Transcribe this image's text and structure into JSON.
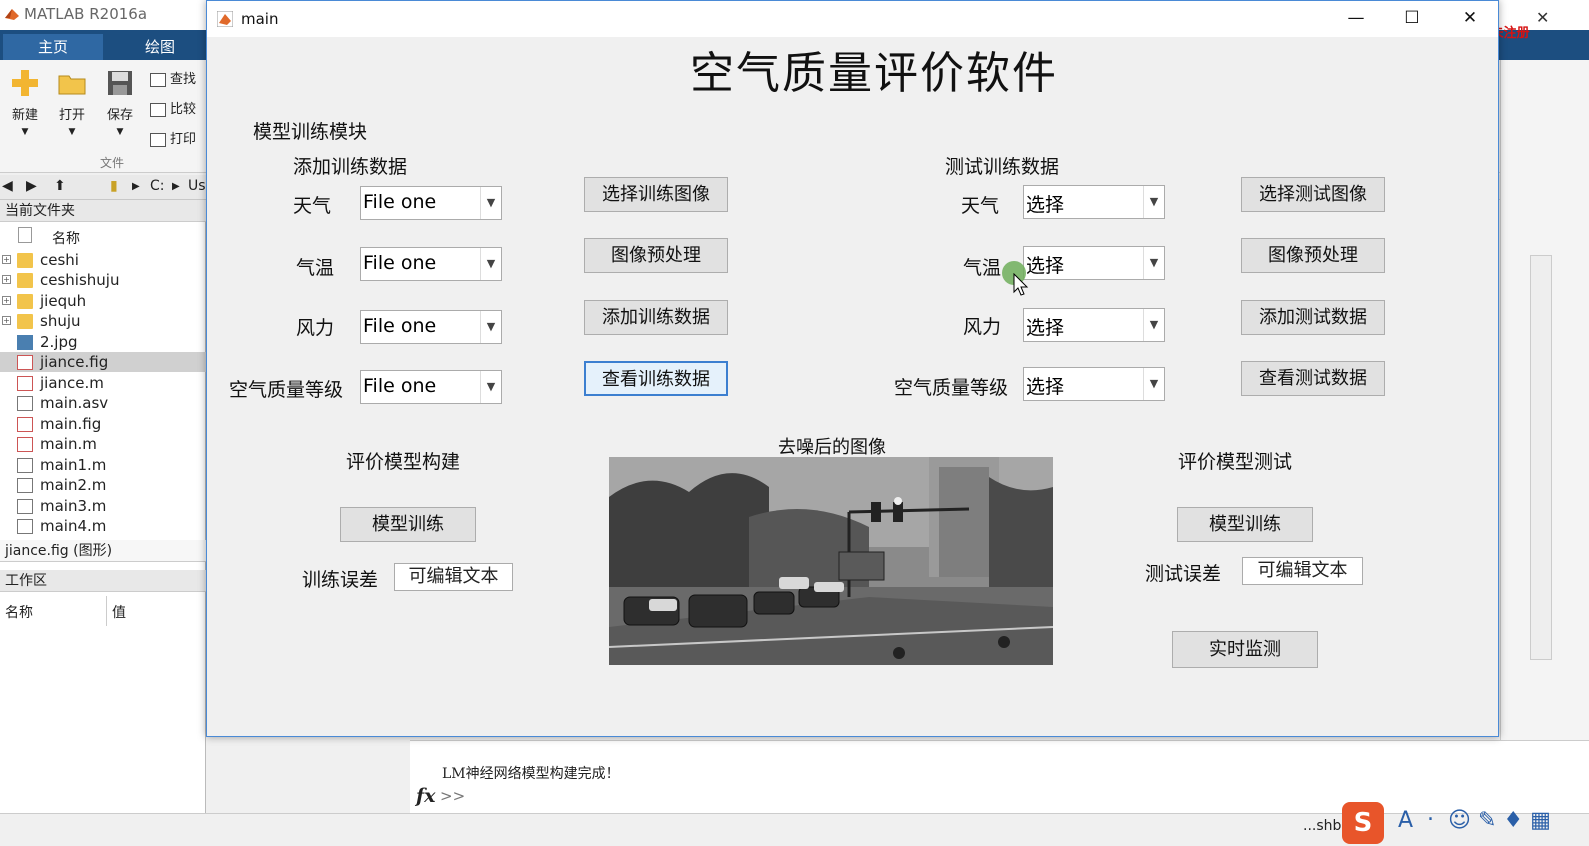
{
  "matlab": {
    "app_title": "MATLAB R2016a",
    "tabs": [
      "主页",
      "绘图"
    ],
    "ribbon": {
      "new": "新建",
      "open": "打开",
      "save": "保存",
      "find": "查找",
      "compare": "比较",
      "print": "打印",
      "group": "文件"
    },
    "address": {
      "drive": "C:",
      "user": "Us"
    },
    "current_folder": {
      "header": "当前文件夹",
      "column": "名称",
      "items": [
        {
          "name": "ceshi",
          "type": "folder"
        },
        {
          "name": "ceshishuju",
          "type": "folder"
        },
        {
          "name": "jiequh",
          "type": "folder"
        },
        {
          "name": "shuju",
          "type": "folder"
        },
        {
          "name": "2.jpg",
          "type": "image"
        },
        {
          "name": "jiance.fig",
          "type": "fig"
        },
        {
          "name": "jiance.m",
          "type": "m"
        },
        {
          "name": "main.asv",
          "type": "doc"
        },
        {
          "name": "main.fig",
          "type": "fig"
        },
        {
          "name": "main.m",
          "type": "m"
        },
        {
          "name": "main1.m",
          "type": "doc"
        },
        {
          "name": "main2.m",
          "type": "doc"
        },
        {
          "name": "main3.m",
          "type": "doc"
        },
        {
          "name": "main4.m",
          "type": "doc"
        }
      ],
      "details": "jiance.fig (图形)"
    },
    "workspace": {
      "header": "工作区",
      "col_name": "名称",
      "col_value": "值"
    },
    "command": {
      "message": "LM神经网络模型构建完成！",
      "fx": "fx",
      "prompt": ">>"
    },
    "recorder": "屏幕录像专家  未注册",
    "taskbar_text": "...shb"
  },
  "window": {
    "title": "main",
    "heading": "空气质量评价软件",
    "train_module": "模型训练模块",
    "add_train_data": "添加训练数据",
    "test_train_data": "测试训练数据",
    "labels": {
      "weather": "天气",
      "temperature": "气温",
      "wind": "风力",
      "aqi": "空气质量等级"
    },
    "train_selects": {
      "weather": "File one",
      "temperature": "File one",
      "wind": "File one",
      "aqi": "File one"
    },
    "test_selects": {
      "weather": "选择",
      "temperature": "选择",
      "wind": "选择",
      "aqi": "选择"
    },
    "train_buttons": {
      "select_image": "选择训练图像",
      "preprocess": "图像预处理",
      "add_data": "添加训练数据",
      "view_data": "查看训练数据"
    },
    "test_buttons": {
      "select_image": "选择测试图像",
      "preprocess": "图像预处理",
      "add_data": "添加测试数据",
      "view_data": "查看测试数据"
    },
    "model_build": {
      "title": "评价模型构建",
      "button": "模型训练",
      "error_label": "训练误差",
      "error_value": "可编辑文本"
    },
    "image_title": "去噪后的图像",
    "model_test": {
      "title": "评价模型测试",
      "button": "模型训练",
      "error_label": "测试误差",
      "error_value": "可编辑文本",
      "monitor": "实时监测"
    }
  }
}
